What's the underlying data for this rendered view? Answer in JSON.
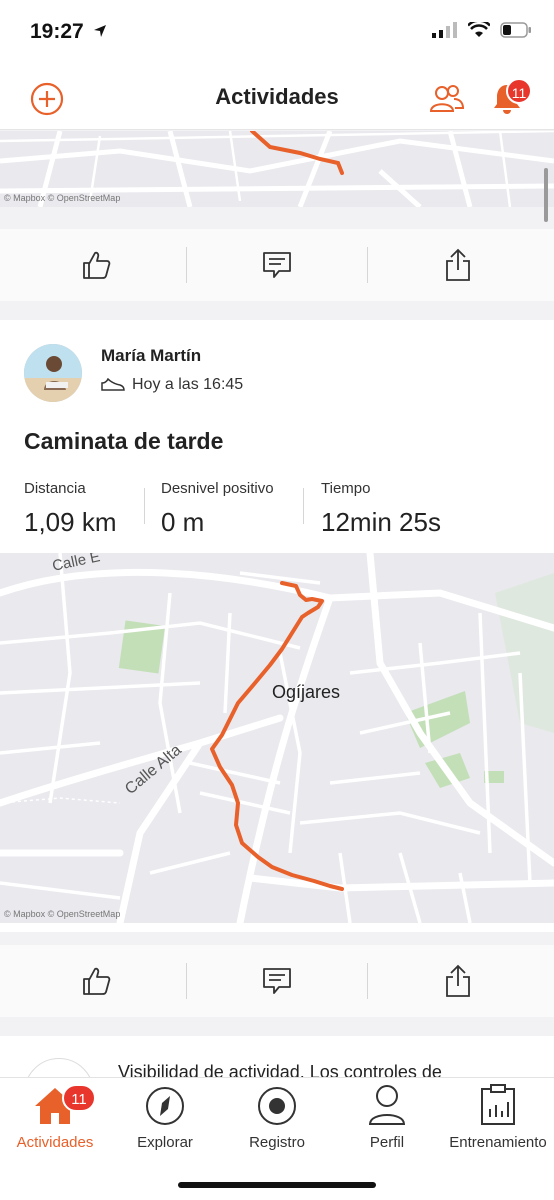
{
  "status": {
    "time": "19:27"
  },
  "header": {
    "title": "Actividades",
    "notification_count": "11"
  },
  "top_map": {
    "attribution": "© Mapbox © OpenStreetMap"
  },
  "activity": {
    "author": "María Martín",
    "time": "Hoy a las 16:45",
    "title": "Caminata de tarde",
    "stats": [
      {
        "label": "Distancia",
        "value": "1,09 km"
      },
      {
        "label": "Desnivel positivo",
        "value": "0 m"
      },
      {
        "label": "Tiempo",
        "value": "12min 25s"
      }
    ],
    "map": {
      "labels": [
        "Calle E",
        "Ogíjares",
        "Calle Alta"
      ],
      "attribution": "© Mapbox © OpenStreetMap"
    }
  },
  "next_card": {
    "text": "Visibilidad de actividad. Los controles de"
  },
  "tabbar": {
    "items": [
      {
        "label": "Actividades",
        "badge": "11"
      },
      {
        "label": "Explorar"
      },
      {
        "label": "Registro"
      },
      {
        "label": "Perfil"
      },
      {
        "label": "Entrenamiento"
      }
    ]
  },
  "colors": {
    "accent": "#e8602a",
    "badge": "#e8362d",
    "route": "#e8602a",
    "map_bg": "#e9e9ee"
  },
  "icons": [
    "plus-circle-icon",
    "friends-icon",
    "bell-icon",
    "thumbs-up-icon",
    "comment-icon",
    "share-icon",
    "shoe-icon",
    "home-icon",
    "compass-icon",
    "record-icon",
    "person-icon",
    "clipboard-chart-icon"
  ]
}
